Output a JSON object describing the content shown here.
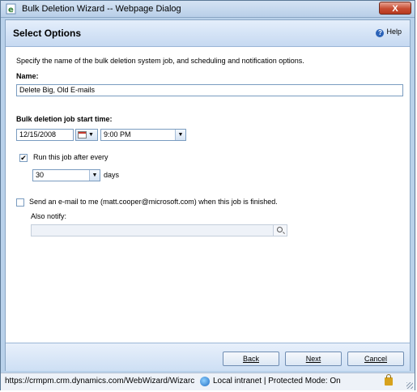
{
  "window": {
    "title": "Bulk Deletion Wizard -- Webpage Dialog",
    "close_label": "X"
  },
  "header": {
    "title": "Select Options",
    "help_label": "Help"
  },
  "form": {
    "intro": "Specify the name of the bulk deletion system job, and scheduling and notification options.",
    "name_label": "Name:",
    "name_value": "Delete Big, Old E-mails",
    "start_label": "Bulk deletion job start time:",
    "start_date": "12/15/2008",
    "start_time": "9:00 PM",
    "recur_checked": true,
    "recur_label": "Run this job after every",
    "recur_value": "30",
    "recur_unit": "days",
    "email_checked": false,
    "email_label": "Send an e-mail to me (matt.cooper@microsoft.com) when this job is finished.",
    "notify_label": "Also notify:",
    "notify_value": ""
  },
  "footer": {
    "back_label": "Back",
    "next_label": "Next",
    "cancel_label": "Cancel"
  },
  "status": {
    "url": "https://crmpm.crm.dynamics.com/WebWizard/Wizarc",
    "zone": "Local intranet | Protected Mode: On"
  },
  "icons": {
    "app": "ie-page-icon",
    "help": "help-icon",
    "calendar": "calendar-icon",
    "lookup": "magnifier-icon",
    "zone": "globe-icon",
    "lock": "lock-icon"
  }
}
